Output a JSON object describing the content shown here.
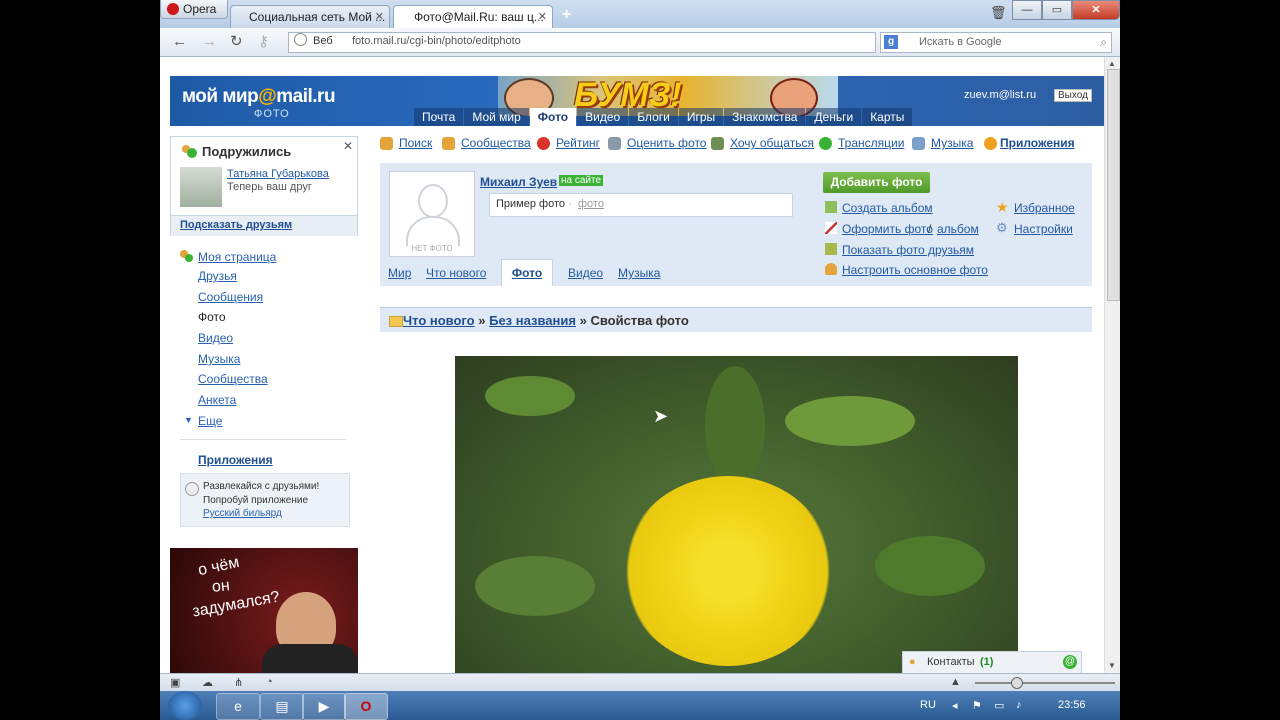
{
  "browser": {
    "opera_label": "Opera",
    "tabs": [
      {
        "label": "Социальная сеть Мой ..."
      },
      {
        "label": "Фото@Mail.Ru: ваш ц..."
      }
    ],
    "web_label": "Веб",
    "url": "foto.mail.ru/cgi-bin/photo/editphoto",
    "search_placeholder": "Искать в Google"
  },
  "header": {
    "logo": "мой мир@mail.ru",
    "logo_sub": "ФОТО",
    "banner_text": "БУМЗ!",
    "nav": [
      "Почта",
      "Мой мир",
      "Фото",
      "Видео",
      "Блоги",
      "Игры",
      "Знакомства",
      "Деньги",
      "Карты"
    ],
    "active_nav": "Фото",
    "user_email": "zuev.m@list.ru",
    "logout_label": "Выход"
  },
  "friends_box": {
    "title": "Подружились",
    "friend_name": "Татьяна Губарькова",
    "friend_status": "Теперь ваш друг",
    "suggest_label": "Подсказать друзьям"
  },
  "sidebar": {
    "items": [
      "Моя страница",
      "Друзья",
      "Сообщения",
      "Фото",
      "Видео",
      "Музыка",
      "Сообщества",
      "Анкета",
      "Еще"
    ],
    "current": "Фото",
    "apps_title": "Приложения",
    "app_line1": "Развлекайся с друзьями!",
    "app_line2": "Попробуй приложение",
    "app_link": "Русский бильярд"
  },
  "ad": {
    "line1": "о чём",
    "line2": "он",
    "line3": "задумался?"
  },
  "top_links": [
    "Поиск",
    "Сообщества",
    "Рейтинг",
    "Оценить фото",
    "Хочу общаться",
    "Трансляции",
    "Музыка",
    "Приложения"
  ],
  "profile": {
    "name": "Михаил Зуев",
    "online_label": "на сайте",
    "no_photo_label": "НЕТ ФОТО",
    "album_text": "Пример фото",
    "album_sep": " · ",
    "album_link": "фото",
    "add_photo_label": "Добавить фото",
    "actions_left": [
      "Создать альбом",
      "Оформить фото",
      "Показать фото друзьям",
      "Настроить основное фото"
    ],
    "album_link2": "альбом",
    "actions_right": [
      "Избранное",
      "Настройки"
    ],
    "tabs": [
      "Мир",
      "Что нового",
      "Фото",
      "Видео",
      "Музыка"
    ],
    "active_tab": "Фото"
  },
  "breadcrumb": {
    "items": [
      "Что нового",
      "Без названия"
    ],
    "sep": "»",
    "current": "Свойства фото"
  },
  "contacts": {
    "label": "Контакты",
    "count": "(1)"
  },
  "taskbar": {
    "lang": "RU",
    "time": "23:56"
  },
  "colors": {
    "brand_blue": "#2b6cc0",
    "link": "#2259a3",
    "online_green": "#3ab334",
    "add_button": "#5fa834"
  }
}
